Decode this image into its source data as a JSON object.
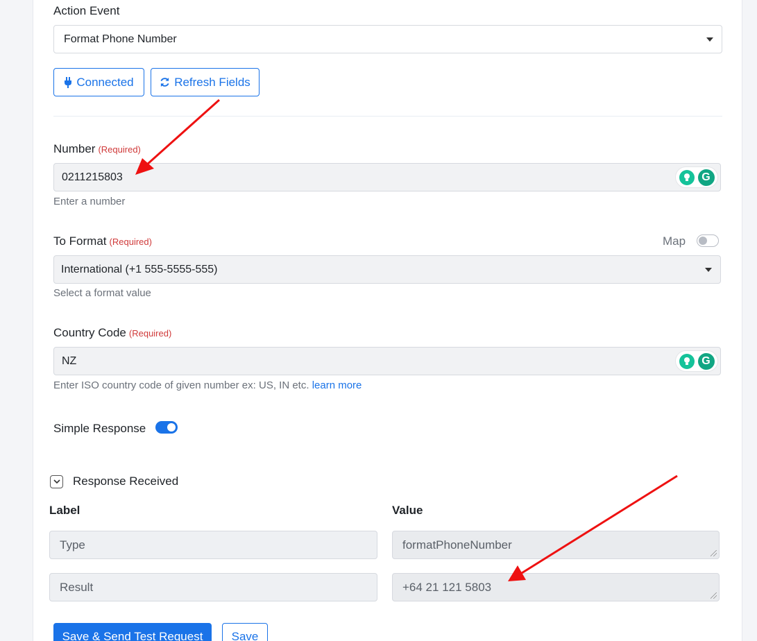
{
  "action_event": {
    "label": "Action Event",
    "selected": "Format Phone Number"
  },
  "buttons": {
    "connected": "Connected",
    "refresh": "Refresh Fields"
  },
  "number": {
    "label": "Number",
    "required": "(Required)",
    "value": "0211215803",
    "help": "Enter a number"
  },
  "to_format": {
    "label": "To Format",
    "required": "(Required)",
    "map_label": "Map",
    "selected": "International (+1 555-5555-555)",
    "help": "Select a format value"
  },
  "country_code": {
    "label": "Country Code",
    "required": "(Required)",
    "value": "NZ",
    "help": "Enter ISO country code of given number ex: US, IN etc.",
    "learn_more": "learn more"
  },
  "simple_response": {
    "label": "Simple Response"
  },
  "response": {
    "title": "Response Received",
    "col_label": "Label",
    "col_value": "Value",
    "rows": [
      {
        "label": "Type",
        "value": "formatPhoneNumber"
      },
      {
        "label": "Result",
        "value": "+64 21 121 5803"
      }
    ]
  },
  "footer": {
    "save_send": "Save & Send Test Request",
    "save": "Save"
  },
  "colors": {
    "accent": "#1a73e8",
    "required": "#d03a3a",
    "annotation_arrow": "#ee1111"
  }
}
